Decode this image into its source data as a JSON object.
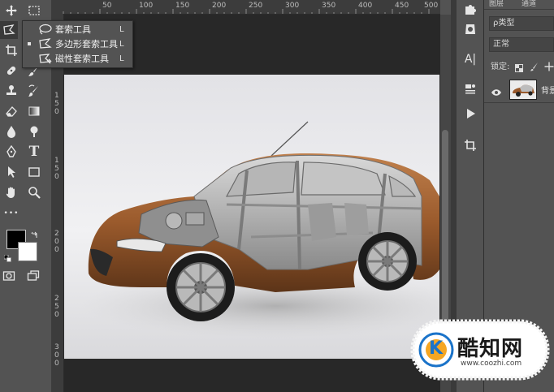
{
  "toolbar": {
    "tools": [
      {
        "name": "move-icon"
      },
      {
        "name": "marquee-icon"
      },
      {
        "name": "lasso-icon"
      },
      {
        "name": "crop-icon"
      },
      {
        "name": "eyedropper-icon"
      },
      {
        "name": "healing-icon"
      },
      {
        "name": "brush-icon"
      },
      {
        "name": "stamp-icon"
      },
      {
        "name": "history-brush-icon"
      },
      {
        "name": "eraser-icon"
      },
      {
        "name": "gradient-icon"
      },
      {
        "name": "blur-icon"
      },
      {
        "name": "dodge-icon"
      },
      {
        "name": "pen-icon"
      },
      {
        "name": "type-icon"
      },
      {
        "name": "path-select-icon"
      },
      {
        "name": "rectangle-icon"
      },
      {
        "name": "hand-icon"
      },
      {
        "name": "zoom-icon"
      }
    ],
    "type_glyph": "T",
    "more_glyph": "•••",
    "foreground_color": "#000000",
    "background_color": "#ffffff"
  },
  "flyout": {
    "items": [
      {
        "label": "套索工具",
        "shortcut": "L",
        "selected": false
      },
      {
        "label": "多边形套索工具",
        "shortcut": "L",
        "selected": true
      },
      {
        "label": "磁性套索工具",
        "shortcut": "L",
        "selected": false
      }
    ]
  },
  "ruler": {
    "horizontal": [
      "50",
      "100",
      "150",
      "200",
      "250",
      "300",
      "350",
      "400",
      "450",
      "500"
    ],
    "vertical": [
      "1",
      "5",
      "0",
      "1",
      "5",
      "0",
      "2",
      "0",
      "0",
      "2",
      "5",
      "0",
      "3",
      "0",
      "0"
    ]
  },
  "midbar": {
    "type_glyph": "A|"
  },
  "panel": {
    "tabs": [
      "图层",
      "通道"
    ],
    "filter_label": "ρ类型",
    "blend_mode": "正常",
    "lock_label": "锁定:",
    "layer_name": "背景"
  },
  "watermark": {
    "logo_letter": "K",
    "title": "酷知网",
    "url": "www.coozhi.com"
  },
  "colors": {
    "ui_gray": "#535353",
    "workspace": "#282828",
    "ruler": "#3c3c3c",
    "car_copper": "#9a5a2c",
    "watermark_blue": "#1a73c9"
  }
}
